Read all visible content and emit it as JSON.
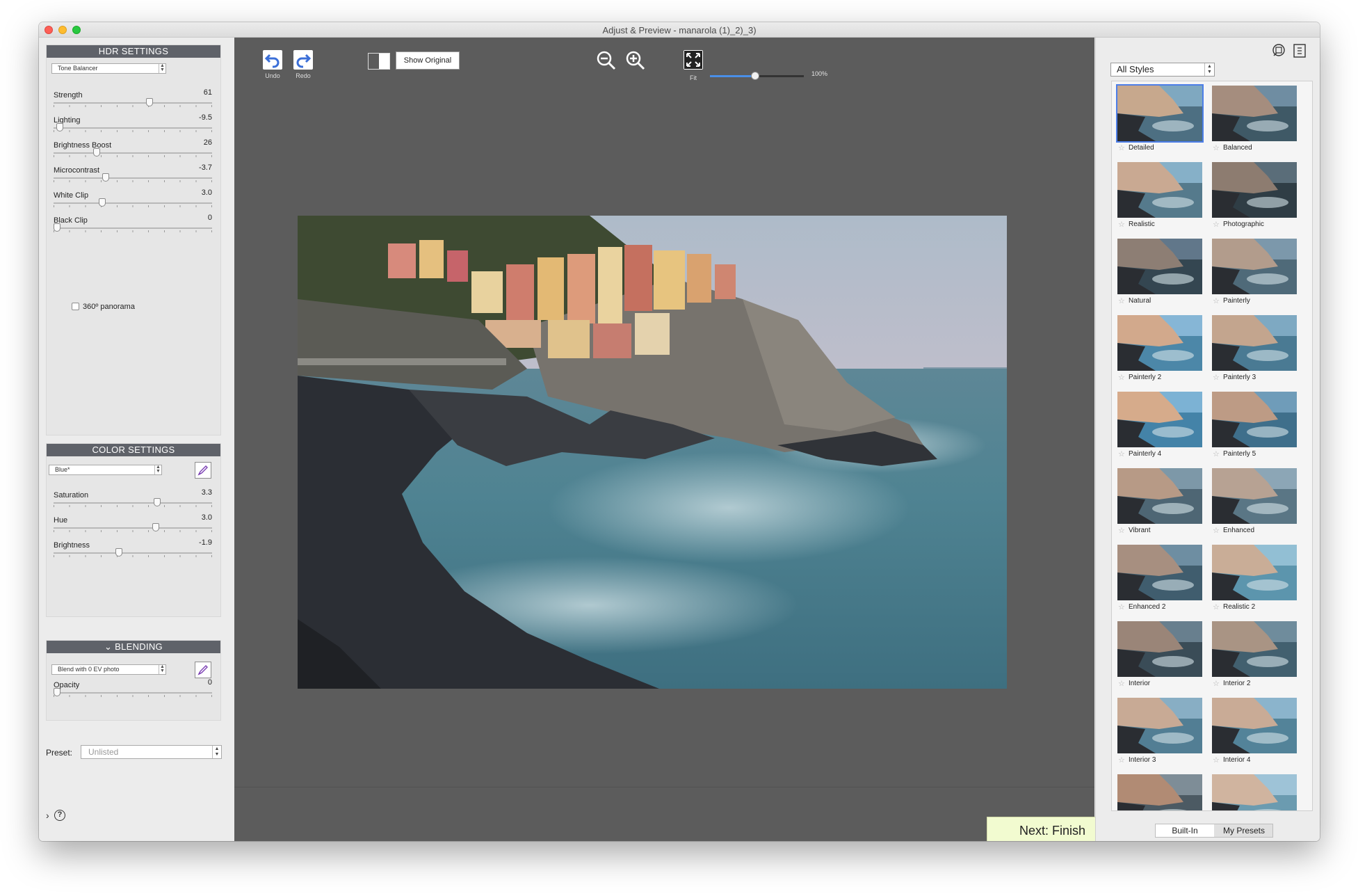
{
  "window": {
    "title": "Adjust & Preview - manarola (1)_2)_3)"
  },
  "hdr": {
    "header": "HDR SETTINGS",
    "method": "Tone Balancer",
    "sliders": [
      {
        "label": "Strength",
        "value": "61",
        "pos": 0.61
      },
      {
        "label": "Lighting",
        "value": "-9.5",
        "pos": 0.02
      },
      {
        "label": "Brightness Boost",
        "value": "26",
        "pos": 0.26
      },
      {
        "label": "Microcontrast",
        "value": "-3.7",
        "pos": 0.32
      },
      {
        "label": "White Clip",
        "value": "3.0",
        "pos": 0.3
      },
      {
        "label": "Black Clip",
        "value": "0",
        "pos": 0.0
      }
    ],
    "panorama_label": "360º panorama"
  },
  "color": {
    "header": "COLOR SETTINGS",
    "channel": "Blue*",
    "sliders": [
      {
        "label": "Saturation",
        "value": "3.3",
        "pos": 0.66
      },
      {
        "label": "Hue",
        "value": "3.0",
        "pos": 0.65
      },
      {
        "label": "Brightness",
        "value": "-1.9",
        "pos": 0.41
      }
    ]
  },
  "blending": {
    "header": "BLENDING",
    "mode": "Blend with  0 EV photo",
    "sliders": [
      {
        "label": "Opacity",
        "value": "0",
        "pos": 0.0
      }
    ]
  },
  "preset": {
    "label": "Preset:",
    "value": "Unlisted"
  },
  "toolbar": {
    "undo": "Undo",
    "redo": "Redo",
    "show_original": "Show Original",
    "fit": "Fit",
    "zoom_value": "100%",
    "zoom_level": 0.48
  },
  "next_button": "Next: Finish",
  "styles": {
    "filter": "All Styles",
    "items": [
      "Detailed",
      "Balanced",
      "Realistic",
      "Photographic",
      "Natural",
      "Painterly",
      "Painterly 2",
      "Painterly 3",
      "Painterly 4",
      "Painterly 5",
      "Vibrant",
      "Enhanced",
      "Enhanced 2",
      "Realistic 2",
      "Interior",
      "Interior 2",
      "Interior 3",
      "Interior 4",
      "",
      ""
    ],
    "tabs": [
      "Built-In",
      "My Presets"
    ]
  },
  "colors": {
    "accent": "#4d7ee8",
    "header_bg": "#5f6269",
    "next_bg": "#f2fbd0"
  }
}
